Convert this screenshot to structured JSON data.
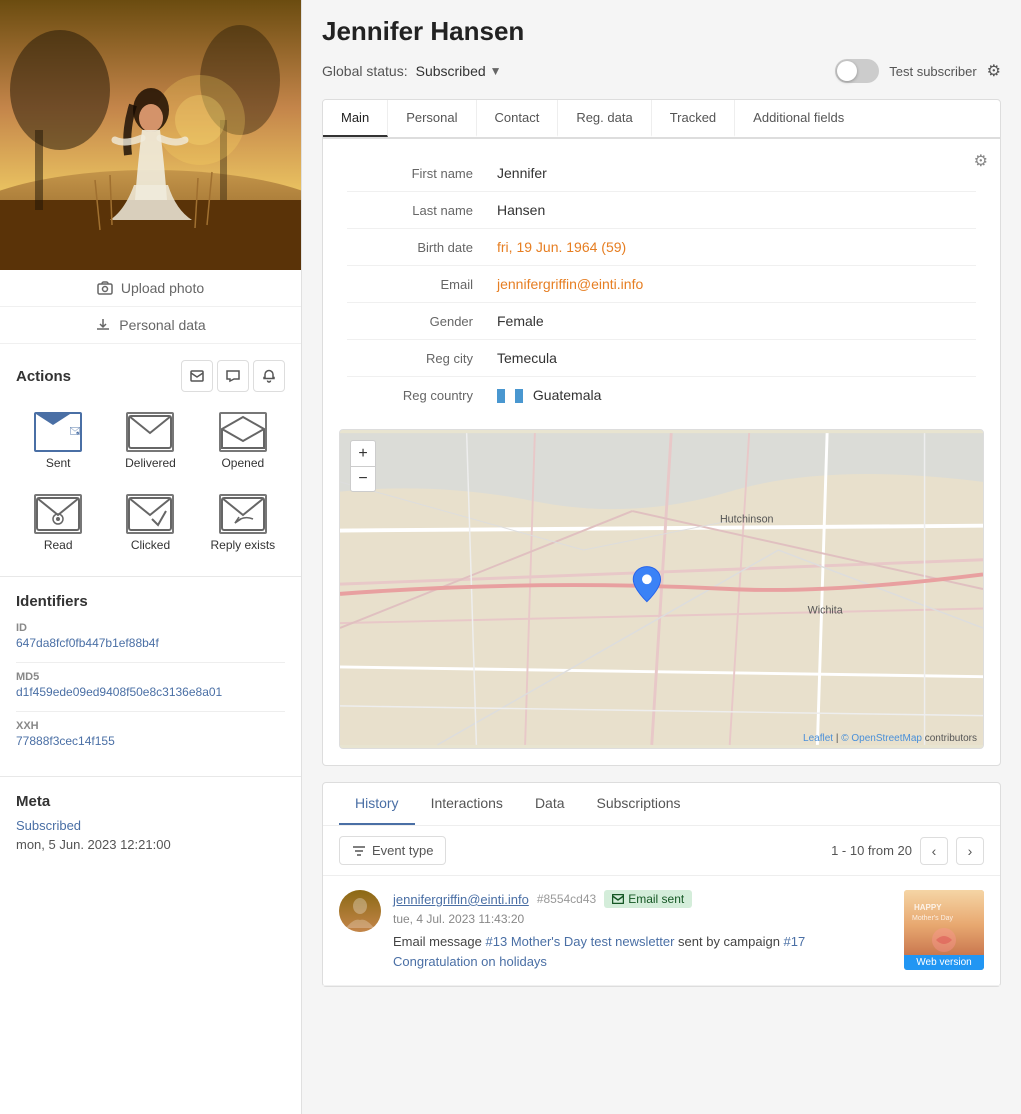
{
  "page": {
    "title": "Jennifer Hansen",
    "global_status_label": "Global status:",
    "global_status_value": "Subscribed",
    "test_subscriber_label": "Test subscriber"
  },
  "tabs": {
    "main": "Main",
    "personal": "Personal",
    "contact": "Contact",
    "reg_data": "Reg. data",
    "tracked": "Tracked",
    "additional_fields": "Additional fields"
  },
  "profile": {
    "first_name_label": "First name",
    "first_name_value": "Jennifer",
    "last_name_label": "Last name",
    "last_name_value": "Hansen",
    "birth_date_label": "Birth date",
    "birth_date_value": "fri, 19 Jun. 1964 (59)",
    "email_label": "Email",
    "email_value": "jennifergriffin@einti.info",
    "gender_label": "Gender",
    "gender_value": "Female",
    "reg_city_label": "Reg city",
    "reg_city_value": "Temecula",
    "reg_country_label": "Reg country",
    "reg_country_value": "Guatemala"
  },
  "map": {
    "zoom_in": "+",
    "zoom_out": "−",
    "attribution": "Leaflet",
    "attribution2": "© OpenStreetMap",
    "attribution3": " contributors",
    "city_label": "Hutchinson",
    "city_label2": "Wichita"
  },
  "sidebar": {
    "upload_photo": "Upload photo",
    "personal_data": "Personal data",
    "actions_title": "Actions",
    "action_items": [
      {
        "label": "Sent"
      },
      {
        "label": "Delivered"
      },
      {
        "label": "Opened"
      },
      {
        "label": "Read"
      },
      {
        "label": "Clicked"
      },
      {
        "label": "Reply exists"
      }
    ],
    "identifiers_title": "Identifiers",
    "id_label": "ID",
    "id_value": "647da8fcf0fb447b1ef88b4f",
    "md5_label": "MD5",
    "md5_value": "d1f459ede09ed9408f50e8c3136e8a01",
    "xxh_label": "XXH",
    "xxh_value": "77888f3cec14f155",
    "meta_title": "Meta",
    "meta_status": "Subscribed",
    "meta_date": "mon, 5 Jun. 2023 12:21:00"
  },
  "bottom": {
    "history_tab": "History",
    "interactions_tab": "Interactions",
    "data_tab": "Data",
    "subscriptions_tab": "Subscriptions",
    "filter_label": "Event type",
    "pagination": "1 - 10 from 20",
    "history_item": {
      "email": "jennifergriffin@einti.info",
      "hash": "#8554cd43",
      "date": "tue, 4 Jul. 2023 11:43:20",
      "badge": "Email sent",
      "text_prefix": "Email message ",
      "campaign_num": "#13",
      "campaign_name": "Mother's Day test newsletter",
      "text_mid": " sent by campaign ",
      "campaign_id": "#17",
      "campaign_name2": "Congratulation on holidays",
      "web_version": "Web version"
    }
  }
}
